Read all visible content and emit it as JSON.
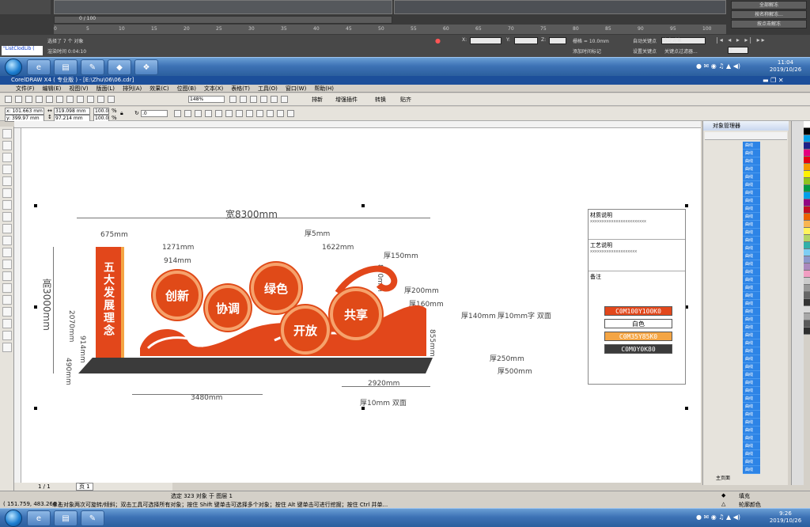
{
  "max": {
    "slider_label": "0 / 100",
    "timeline_ticks": [
      "0",
      "5",
      "10",
      "15",
      "20",
      "25",
      "30",
      "35",
      "40",
      "45",
      "50",
      "55",
      "60",
      "65",
      "70",
      "75",
      "80",
      "85",
      "90",
      "95",
      "100"
    ],
    "side_buttons": [
      "全部解冻",
      "按名称解冻...",
      "按点击解冻"
    ],
    "selected_status": "选择了 7 个 对象",
    "render_time": "渲染时间 0:04:10",
    "grid_label": "栅格 = 10.0mm",
    "auto_key": "自动关键点",
    "set_key": "设置关键点",
    "select_obj": "选定对象",
    "key_filters": "关键点过滤器...",
    "add_time_tag": "添加时间标记",
    "frame_value": "0",
    "cmd_text": "\"ListClodLib ("
  },
  "taskbar_top": {
    "time": "11:04",
    "date": "2019/10/26"
  },
  "taskbar_bottom": {
    "time": "9:26",
    "date": "2019/10/26"
  },
  "corel": {
    "title": "CorelDRAW X4 ( 专业版 ) - [E:\\Zhu\\06\\06.cdr]",
    "menus": [
      "文件(F)",
      "编辑(E)",
      "视图(V)",
      "版面(L)",
      "排列(A)",
      "效果(C)",
      "位图(B)",
      "文本(X)",
      "表格(T)",
      "工具(O)",
      "窗口(W)",
      "帮助(H)"
    ],
    "zoom": "148%",
    "btn_arrange": "排新",
    "btn_plugin": "增强插件",
    "btn_convert": "转换",
    "btn_paste": "贴齐",
    "x_pos": "x: 101.663 mm",
    "y_pos": "y: 399.97 mm",
    "w_size": "319.098 mm",
    "h_size": "97.214 mm",
    "scale_x": "100.0",
    "scale_y": "100.0",
    "percent": "%",
    "angle": ".0",
    "docker_title": "对象管理器",
    "docker_item": "曲线",
    "docker_footer": "主页面",
    "page_nav": "1 / 1",
    "page_tab": "页 1",
    "status_center": "选定 323 对象 于 图层 1",
    "status_coords": "( 151.759, 483.264 )",
    "status_hint": "单击对象两次可旋转/倾斜；双击工具可选择所有对象；按住 Shift 键单击可选择多个对象；按住 Alt 键单击可进行挖掘；按住 Ctrl 并单...",
    "fill_label": "填充",
    "outline_label": "轮廓颜色"
  },
  "sign": {
    "pillar_text": "五大发展理念",
    "circles": [
      "创新",
      "协调",
      "绿色",
      "开放",
      "共享"
    ],
    "dims": {
      "width": "宽8300mm",
      "height": "高3000mm",
      "d675": "675mm",
      "d1271": "1271mm",
      "d914a": "914mm",
      "d914b": "914mm",
      "d2070": "2070mm",
      "d490": "490mm",
      "d1622": "1622mm",
      "d5": "厚5mm",
      "d150": "厚150mm",
      "d870": "870mm",
      "d200": "厚200mm",
      "d160": "厚160mm",
      "d140": "厚140mm",
      "d10": "厚10mm字 双面",
      "d855": "855mm",
      "d250": "厚250mm",
      "d500": "厚500mm",
      "d2920": "2920mm",
      "d3480": "3480mm",
      "d10b": "厚10mm 双面"
    },
    "notes": {
      "n1": "材质说明",
      "n1_sub": "xxxxxxxxxxxxxxxxxxxxxxxx",
      "n2": "工艺说明",
      "n2_sub": "xxxxxxxxxxxxxxxxxxxx",
      "n3": "备注"
    },
    "swatches": [
      {
        "label": "C0M100Y100K0",
        "color": "#e2471b",
        "text": "#ffffff"
      },
      {
        "label": "白色",
        "color": "#ffffff",
        "text": "#000000"
      },
      {
        "label": "C0M35Y85K0",
        "color": "#f4a544",
        "text": "#ffffff"
      },
      {
        "label": "C0M0Y0K80",
        "color": "#3b3b3b",
        "text": "#ffffff"
      }
    ]
  }
}
